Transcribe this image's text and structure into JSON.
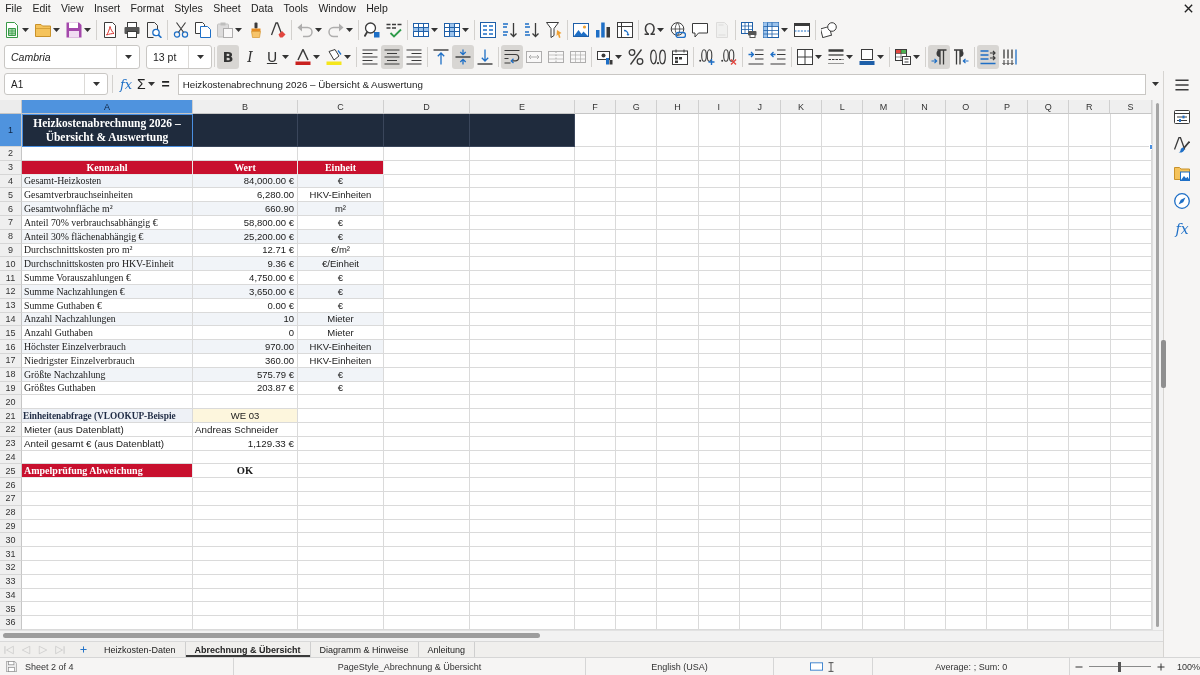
{
  "menu_bar": [
    "File",
    "Edit",
    "View",
    "Insert",
    "Format",
    "Styles",
    "Sheet",
    "Data",
    "Tools",
    "Window",
    "Help"
  ],
  "standard_toolbar": [
    {
      "disabled": false
    },
    {
      "disabled": false
    },
    {
      "disabled": false
    },
    {
      "disabled": false
    },
    {
      "disabled": false
    },
    {
      "disabled": false
    },
    {
      "disabled": false
    },
    {
      "disabled": false
    },
    {
      "disabled": true
    },
    {
      "disabled": false
    },
    {
      "disabled": false
    },
    {
      "disabled": true
    },
    {
      "disabled": true
    },
    {
      "disabled": false
    },
    {
      "disabled": false
    },
    {
      "disabled": false
    },
    {
      "disabled": false
    },
    {
      "disabled": false
    },
    {
      "disabled": false
    },
    {
      "disabled": false
    },
    {
      "disabled": false
    },
    {
      "disabled": false
    },
    {
      "disabled": false
    },
    {
      "disabled": false
    },
    {
      "label": "Ω",
      "disabled": false
    },
    {
      "disabled": false
    },
    {
      "disabled": false
    },
    {
      "disabled": true
    },
    {
      "disabled": false
    },
    {
      "disabled": false
    },
    {
      "disabled": false
    },
    {
      "disabled": false
    }
  ],
  "formatting_toolbar": {
    "font_name": "Cambria",
    "font_size": "13 pt",
    "text_style": [
      {
        "label": "B",
        "selected": true
      },
      {
        "label": "I",
        "selected": false
      },
      {
        "label": "U",
        "selected": false
      }
    ],
    "horizontal_alignment": [
      {
        "selected": false
      },
      {
        "selected": true
      },
      {
        "selected": false
      }
    ],
    "vertical_alignment": [
      {
        "selected": false
      },
      {
        "selected": true
      },
      {
        "selected": false
      }
    ],
    "wrap_text": {
      "selected": true
    },
    "merge": [
      {
        "disabled": true
      },
      {
        "disabled": true
      },
      {
        "disabled": true
      }
    ],
    "paragraph_direction": [
      {
        "selected": true
      },
      {
        "selected": false
      }
    ],
    "text_orientation": [
      {
        "selected": true
      },
      {
        "selected": false
      }
    ]
  },
  "formula_bar": {
    "name_box": "A1",
    "function_wizard": "fx",
    "sum": "Σ",
    "equals": "=",
    "content": "Heizkostenabrechnung 2026 – Übersicht & Auswertung"
  },
  "sheet": {
    "columns": [
      {
        "label": "A",
        "selected": true
      },
      {
        "label": "B",
        "selected": false
      },
      {
        "label": "C",
        "selected": false
      },
      {
        "label": "D",
        "selected": false
      },
      {
        "label": "E",
        "selected": false
      },
      {
        "label": "F",
        "selected": false
      },
      {
        "label": "G",
        "selected": false
      },
      {
        "label": "H",
        "selected": false
      },
      {
        "label": "I",
        "selected": false
      },
      {
        "label": "J",
        "selected": false
      },
      {
        "label": "K",
        "selected": false
      },
      {
        "label": "L",
        "selected": false
      },
      {
        "label": "M",
        "selected": false
      },
      {
        "label": "N",
        "selected": false
      },
      {
        "label": "O",
        "selected": false
      },
      {
        "label": "P",
        "selected": false
      },
      {
        "label": "Q",
        "selected": false
      },
      {
        "label": "R",
        "selected": false
      },
      {
        "label": "S",
        "selected": false
      }
    ],
    "rows": [
      {
        "header": "1",
        "selected": true,
        "kind": "title",
        "cells": [
          "Heizkostenabrechnung 2026 – Übersicht & Auswertung"
        ]
      },
      {
        "header": "2",
        "selected": false,
        "kind": "empty"
      },
      {
        "header": "3",
        "selected": false,
        "kind": "table_header",
        "cells": [
          "Kennzahl",
          "Wert",
          "Einheit"
        ]
      },
      {
        "header": "4",
        "selected": false,
        "kind": "data",
        "banded": true,
        "cells": [
          "Gesamt-Heizkosten",
          "84,000.00 €",
          "€"
        ]
      },
      {
        "header": "5",
        "selected": false,
        "kind": "data",
        "banded": false,
        "cells": [
          "Gesamtverbrauchseinheiten",
          "6,280.00",
          "HKV-Einheiten"
        ]
      },
      {
        "header": "6",
        "selected": false,
        "kind": "data",
        "banded": true,
        "cells": [
          "Gesamtwohnfläche m²",
          "660.90",
          "m²"
        ]
      },
      {
        "header": "7",
        "selected": false,
        "kind": "data",
        "banded": false,
        "cells": [
          "Anteil 70% verbrauchsabhängig €",
          "58,800.00 €",
          "€"
        ]
      },
      {
        "header": "8",
        "selected": false,
        "kind": "data",
        "banded": true,
        "cells": [
          "Anteil 30% flächenabhängig €",
          "25,200.00 €",
          "€"
        ]
      },
      {
        "header": "9",
        "selected": false,
        "kind": "data",
        "banded": false,
        "cells": [
          "Durchschnittskosten pro m²",
          "12.71 €",
          "€/m²"
        ]
      },
      {
        "header": "10",
        "selected": false,
        "kind": "data",
        "banded": true,
        "cells": [
          "Durchschnittskosten pro HKV-Einheit",
          "9.36 €",
          "€/Einheit"
        ]
      },
      {
        "header": "11",
        "selected": false,
        "kind": "data",
        "banded": false,
        "cells": [
          "Summe Vorauszahlungen €",
          "4,750.00 €",
          "€"
        ]
      },
      {
        "header": "12",
        "selected": false,
        "kind": "data",
        "banded": true,
        "cells": [
          "Summe Nachzahlungen €",
          "3,650.00 €",
          "€"
        ]
      },
      {
        "header": "13",
        "selected": false,
        "kind": "data",
        "banded": false,
        "cells": [
          "Summe Guthaben €",
          "0.00 €",
          "€"
        ]
      },
      {
        "header": "14",
        "selected": false,
        "kind": "data",
        "banded": true,
        "cells": [
          "Anzahl Nachzahlungen",
          "10",
          "Mieter"
        ]
      },
      {
        "header": "15",
        "selected": false,
        "kind": "data",
        "banded": false,
        "cells": [
          "Anzahl Guthaben",
          "0",
          "Mieter"
        ]
      },
      {
        "header": "16",
        "selected": false,
        "kind": "data",
        "banded": true,
        "cells": [
          "Höchster Einzelverbrauch",
          "970.00",
          "HKV-Einheiten"
        ]
      },
      {
        "header": "17",
        "selected": false,
        "kind": "data",
        "banded": false,
        "cells": [
          "Niedrigster Einzelverbrauch",
          "360.00",
          "HKV-Einheiten"
        ]
      },
      {
        "header": "18",
        "selected": false,
        "kind": "data",
        "banded": true,
        "cells": [
          "Größte Nachzahlung",
          "575.79 €",
          "€"
        ]
      },
      {
        "header": "19",
        "selected": false,
        "kind": "data",
        "banded": false,
        "cells": [
          "Größtes Guthaben",
          "203.87 €",
          "€"
        ]
      },
      {
        "header": "20",
        "selected": false,
        "kind": "empty"
      },
      {
        "header": "21",
        "selected": false,
        "kind": "lookup",
        "cells": [
          "Einheitenabfrage (VLOOKUP-Beispie",
          "WE 03"
        ]
      },
      {
        "header": "22",
        "selected": false,
        "kind": "lookup_text",
        "cells": [
          "Mieter (aus Datenblatt)",
          "Andreas Schneider"
        ]
      },
      {
        "header": "23",
        "selected": false,
        "kind": "lookup_amount",
        "cells": [
          "Anteil gesamt € (aus Datenblatt)",
          "1,129.33 €"
        ]
      },
      {
        "header": "24",
        "selected": false,
        "kind": "empty"
      },
      {
        "header": "25",
        "selected": false,
        "kind": "status",
        "cells": [
          "Ampelprüfung Abweichung",
          "OK"
        ]
      },
      {
        "header": "26",
        "selected": false,
        "kind": "empty"
      },
      {
        "header": "27",
        "selected": false,
        "kind": "empty"
      },
      {
        "header": "28",
        "selected": false,
        "kind": "empty"
      },
      {
        "header": "29",
        "selected": false,
        "kind": "empty"
      },
      {
        "header": "30",
        "selected": false,
        "kind": "empty"
      },
      {
        "header": "31",
        "selected": false,
        "kind": "empty"
      },
      {
        "header": "32",
        "selected": false,
        "kind": "empty"
      },
      {
        "header": "33",
        "selected": false,
        "kind": "empty"
      },
      {
        "header": "34",
        "selected": false,
        "kind": "empty"
      },
      {
        "header": "35",
        "selected": false,
        "kind": "empty"
      },
      {
        "header": "36",
        "selected": false,
        "kind": "empty"
      }
    ]
  },
  "sheet_tabs": [
    {
      "label": "Heizkosten-Daten",
      "selected": false
    },
    {
      "label": "Abrechnung & Übersicht",
      "selected": true
    },
    {
      "label": "Diagramm & Hinweise",
      "selected": false
    },
    {
      "label": "Anleitung",
      "selected": false
    }
  ],
  "sidebar": {
    "functions_tab": "fx"
  },
  "status_bar": {
    "sheet": "Sheet 2 of 4",
    "page_style": "PageStyle_Abrechnung & Übersicht",
    "language": "English (USA)",
    "selection_summary": "Average: ; Sum: 0",
    "zoom": {
      "level": 0.5,
      "reading": "100%"
    }
  }
}
